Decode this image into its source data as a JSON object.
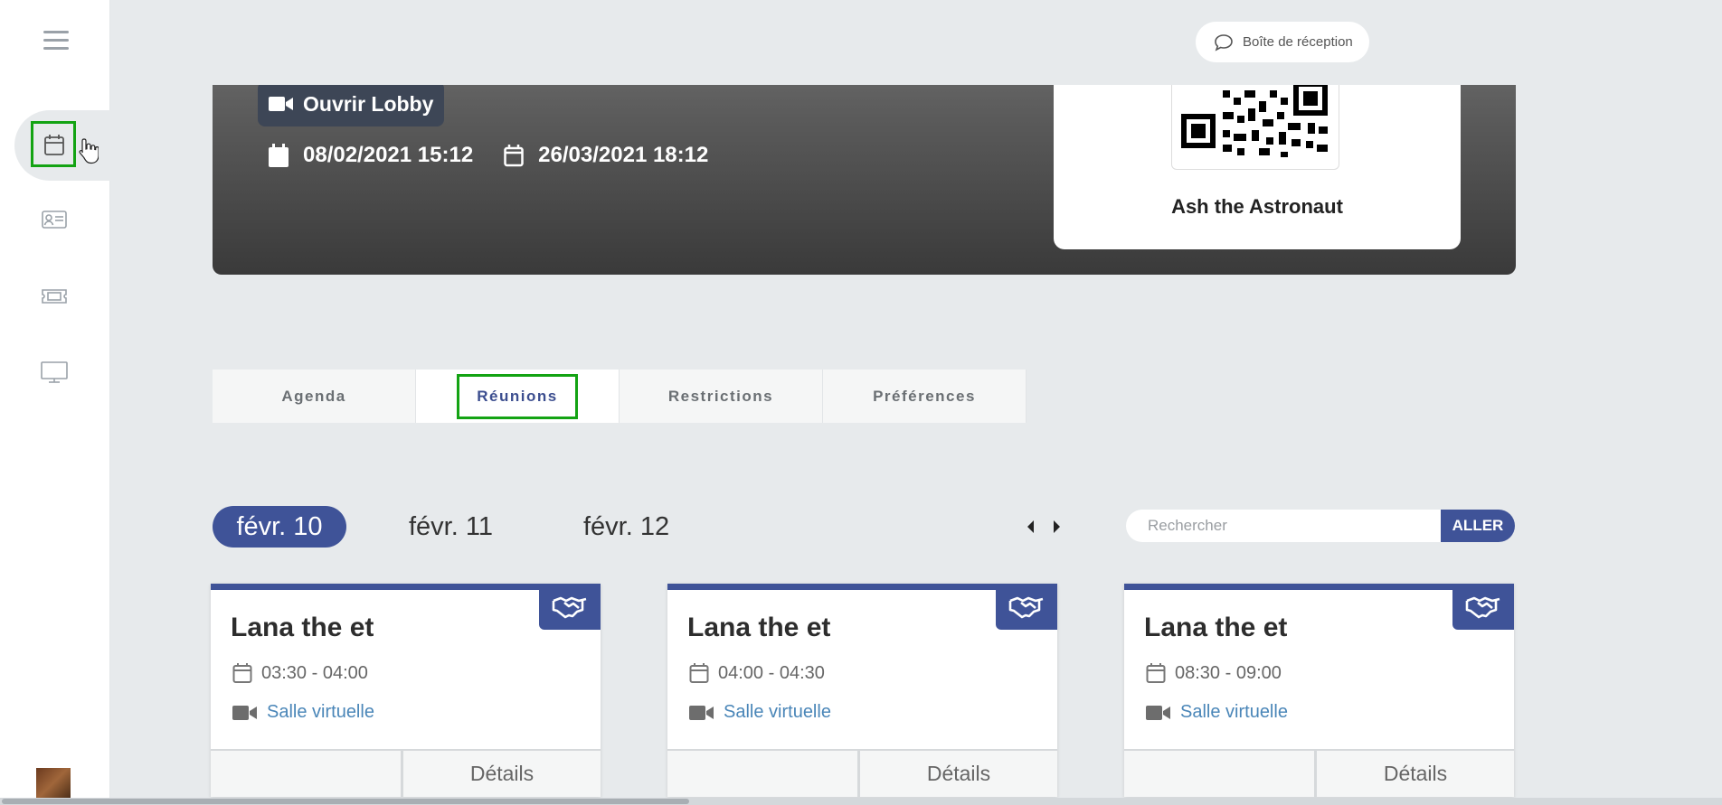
{
  "header": {
    "inbox_label": "Boîte de réception"
  },
  "banner": {
    "lobby_label": "Ouvrir Lobby",
    "start_date": "08/02/2021 15:12",
    "end_date": "26/03/2021 18:12",
    "qr_name": "Ash the Astronaut"
  },
  "tabs": [
    {
      "label": "Agenda"
    },
    {
      "label": "Réunions"
    },
    {
      "label": "Restrictions"
    },
    {
      "label": "Préférences"
    }
  ],
  "days": [
    {
      "label": "févr. 10"
    },
    {
      "label": "févr. 11"
    },
    {
      "label": "févr. 12"
    }
  ],
  "search": {
    "placeholder": "Rechercher",
    "button_label": "ALLER"
  },
  "meetings": [
    {
      "title": "Lana the et",
      "time": "03:30 - 04:00",
      "room": "Salle virtuelle",
      "details_label": "Détails"
    },
    {
      "title": "Lana the et",
      "time": "04:00 - 04:30",
      "room": "Salle virtuelle",
      "details_label": "Détails"
    },
    {
      "title": "Lana the et",
      "time": "08:30 - 09:00",
      "room": "Salle virtuelle",
      "details_label": "Détails"
    }
  ],
  "colors": {
    "accent": "#3f5398",
    "highlight": "#13a313",
    "banner_dark": "#3a3a3a",
    "link": "#4a86b8"
  },
  "icons": {
    "menu": "hamburger-icon",
    "calendar": "calendar-icon",
    "contacts": "id-card-icon",
    "tickets": "ticket-icon",
    "monitor": "monitor-icon",
    "inbox": "speech-bubble-icon",
    "video": "video-camera-icon",
    "meeting_type": "handshake-icon"
  }
}
